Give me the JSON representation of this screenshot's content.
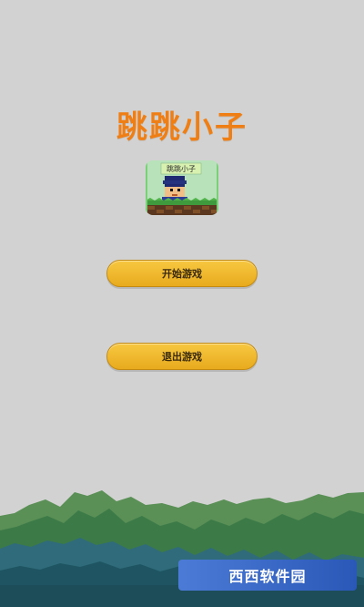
{
  "game": {
    "title": "跳跳小子",
    "icon": {
      "label": "跳跳小子"
    }
  },
  "buttons": {
    "start": "开始游戏",
    "exit": "退出游戏"
  },
  "watermark": {
    "text": "西西软件园"
  },
  "colors": {
    "background": "#d2d2d2",
    "title": "#ef7f14",
    "button": "#f2b732"
  }
}
